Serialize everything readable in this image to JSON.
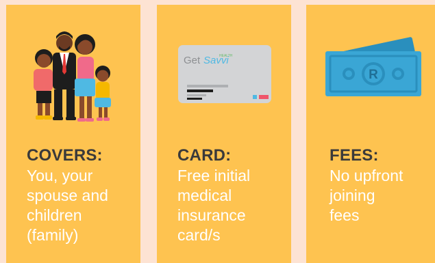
{
  "cards": [
    {
      "title": "COVERS:",
      "description": "You, your\nspouse and\nchildren\n(family)",
      "icon": "family-icon"
    },
    {
      "title": "CARD:",
      "description": "Free initial\nmedical\ninsurance\ncard/s",
      "icon": "medical-card-icon",
      "card_brand": {
        "get": "Get",
        "savvi": "Savvi",
        "health": "HEALTH"
      }
    },
    {
      "title": "FEES:",
      "description": "No upfront\njoining\nfees",
      "icon": "money-icon",
      "currency_symbol": "R"
    }
  ],
  "colors": {
    "background": "#fde3d3",
    "panel": "#fec350",
    "title_text": "#3a3a3a",
    "description_text": "#ffffff",
    "money": "#3aa6d5"
  }
}
